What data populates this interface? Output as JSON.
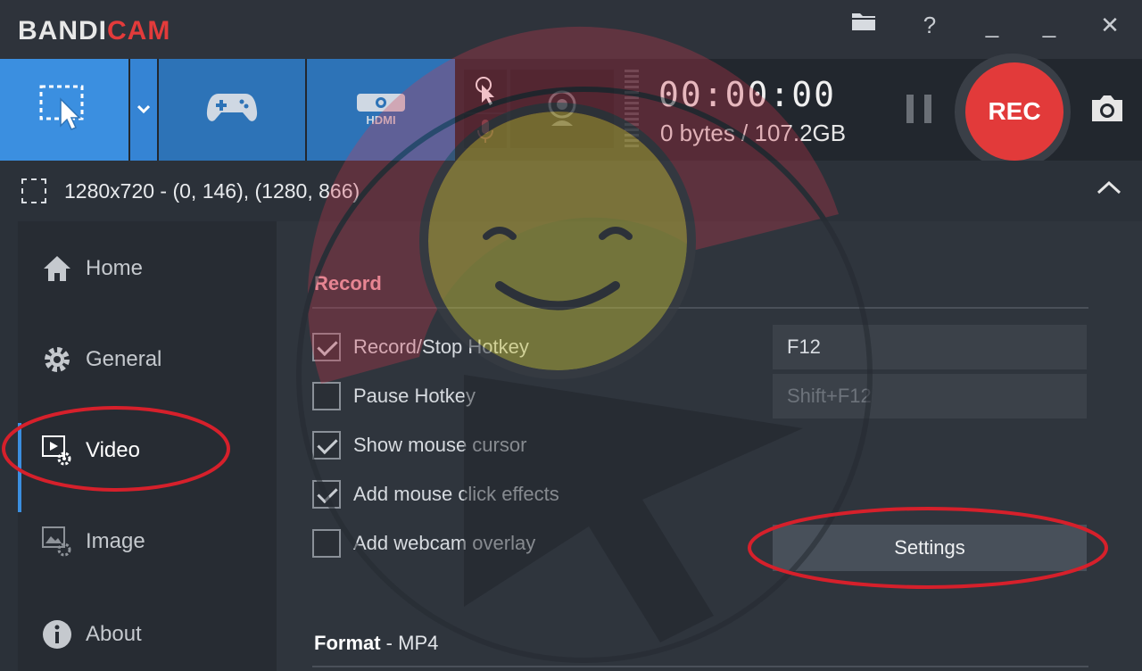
{
  "app": {
    "logo_part1": "BANDI",
    "logo_part2": "CAM",
    "brand_red": "#e33b3b"
  },
  "titlebar": {
    "folder_icon": "folder-icon",
    "help_label": "?",
    "minimize_label": "_",
    "close_label": "✕"
  },
  "toolbar": {
    "modes": [
      {
        "name": "screen-rectangle-mode",
        "icon": "rectangle-cursor-icon",
        "active": true
      },
      {
        "name": "game-mode",
        "icon": "gamepad-icon",
        "active": false
      },
      {
        "name": "device-mode",
        "icon": "hdmi-icon",
        "active": false
      }
    ],
    "timer": "00:00:00",
    "bytes": "0 bytes / 107.2GB",
    "rec_label": "REC",
    "accent": "#3b8fe0",
    "rec_color": "#e23a3a"
  },
  "region": {
    "text": "1280x720 - (0, 146), (1280, 866)"
  },
  "sidebar": {
    "items": [
      {
        "label": "Home",
        "icon": "home-icon"
      },
      {
        "label": "General",
        "icon": "gear-icon"
      },
      {
        "label": "Video",
        "icon": "video-settings-icon",
        "active": true
      },
      {
        "label": "Image",
        "icon": "image-settings-icon"
      },
      {
        "label": "About",
        "icon": "info-icon"
      }
    ]
  },
  "record": {
    "title": "Record",
    "options": [
      {
        "label": "Record/Stop Hotkey",
        "checked": true
      },
      {
        "label": "Pause Hotkey",
        "checked": false
      },
      {
        "label": "Show mouse cursor",
        "checked": true
      },
      {
        "label": "Add mouse click effects",
        "checked": true
      },
      {
        "label": "Add webcam overlay",
        "checked": false
      }
    ],
    "hotkey_record": "F12",
    "hotkey_pause": "Shift+F12",
    "settings_label": "Settings"
  },
  "format": {
    "label": "Format",
    "value": " - MP4"
  }
}
